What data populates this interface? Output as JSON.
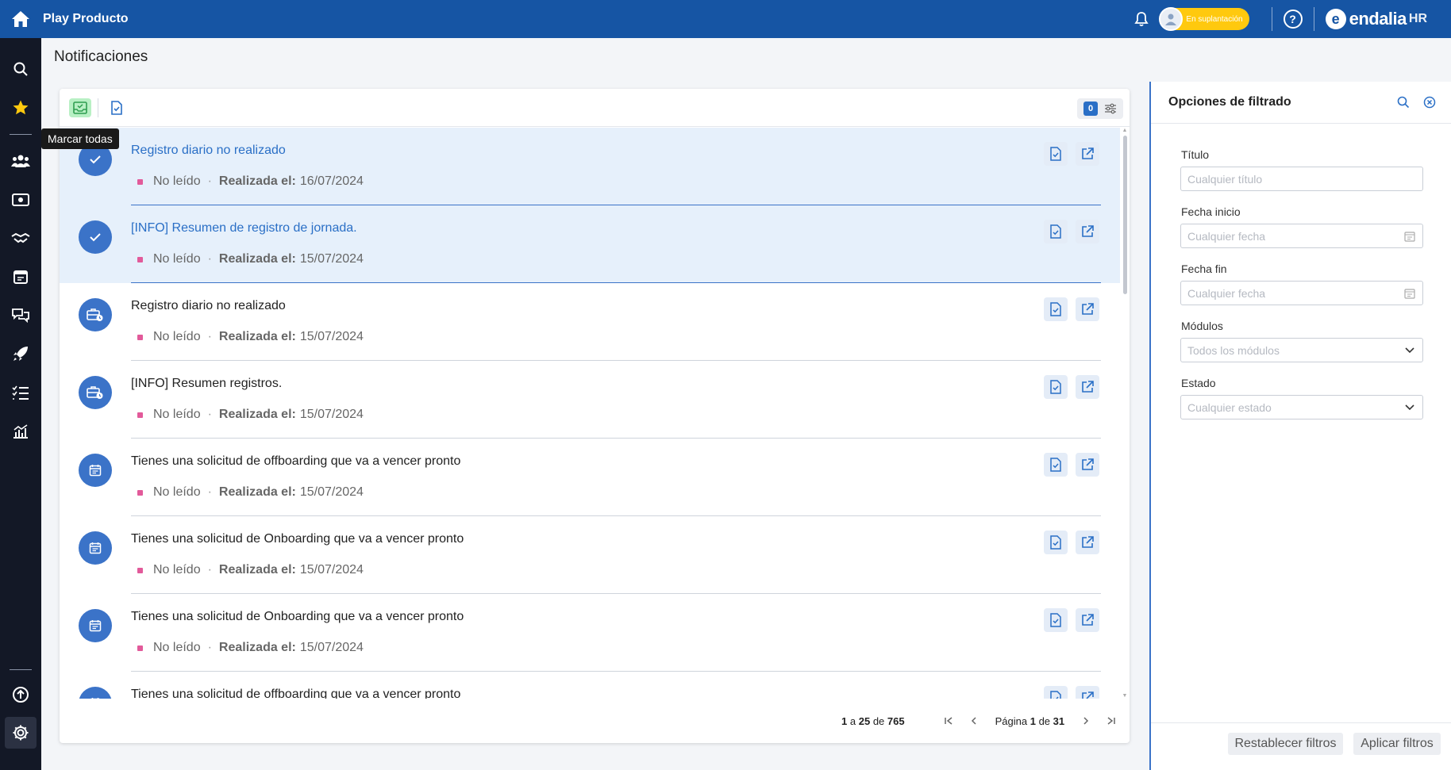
{
  "app": {
    "title": "Play Producto",
    "impersonation": "En suplantación",
    "brand": "endalia",
    "brand_suffix": "HR"
  },
  "page": {
    "title": "Notificaciones"
  },
  "toolbar": {
    "mark_all_tooltip": "Marcar todas",
    "filter_count": "0"
  },
  "notifications": [
    {
      "title": "Registro diario no realizado",
      "status": "No leído",
      "date_label": "Realizada el:",
      "date": "16/07/2024",
      "icon": "check-icon",
      "selected": true
    },
    {
      "title": "[INFO] Resumen de registro de jornada.",
      "status": "No leído",
      "date_label": "Realizada el:",
      "date": "15/07/2024",
      "icon": "check-icon",
      "selected": true
    },
    {
      "title": "Registro diario no realizado",
      "status": "No leído",
      "date_label": "Realizada el:",
      "date": "15/07/2024",
      "icon": "briefcase-clock-icon",
      "selected": false
    },
    {
      "title": "[INFO] Resumen registros.",
      "status": "No leído",
      "date_label": "Realizada el:",
      "date": "15/07/2024",
      "icon": "briefcase-clock-icon",
      "selected": false
    },
    {
      "title": "Tienes una solicitud de offboarding que va a vencer pronto",
      "status": "No leído",
      "date_label": "Realizada el:",
      "date": "15/07/2024",
      "icon": "calendar-icon",
      "selected": false
    },
    {
      "title": "Tienes una solicitud de Onboarding que va a vencer pronto",
      "status": "No leído",
      "date_label": "Realizada el:",
      "date": "15/07/2024",
      "icon": "calendar-icon",
      "selected": false
    },
    {
      "title": "Tienes una solicitud de Onboarding que va a vencer pronto",
      "status": "No leído",
      "date_label": "Realizada el:",
      "date": "15/07/2024",
      "icon": "calendar-icon",
      "selected": false
    },
    {
      "title": "Tienes una solicitud de offboarding que va a vencer pronto",
      "status": "",
      "date_label": "",
      "date": "",
      "icon": "calendar-icon",
      "selected": false
    }
  ],
  "pager": {
    "from": "1",
    "a": "a",
    "to": "25",
    "de": "de",
    "total": "765",
    "page_label": "Página",
    "page": "1",
    "page_de": "de",
    "pages": "31"
  },
  "filters": {
    "title": "Opciones de filtrado",
    "titulo_label": "Título",
    "titulo_placeholder": "Cualquier título",
    "inicio_label": "Fecha inicio",
    "inicio_placeholder": "Cualquier fecha",
    "fin_label": "Fecha fin",
    "fin_placeholder": "Cualquier fecha",
    "modulos_label": "Módulos",
    "modulos_value": "Todos los módulos",
    "estado_label": "Estado",
    "estado_value": "Cualquier estado",
    "reset_label": "Restablecer filtros",
    "apply_label": "Aplicar filtros"
  },
  "colors": {
    "topbar": "#1655a4",
    "sidebar": "#131826",
    "accent": "#3b73c8",
    "unread_dot": "#e25a9a",
    "impersonation": "#ffc90e"
  }
}
